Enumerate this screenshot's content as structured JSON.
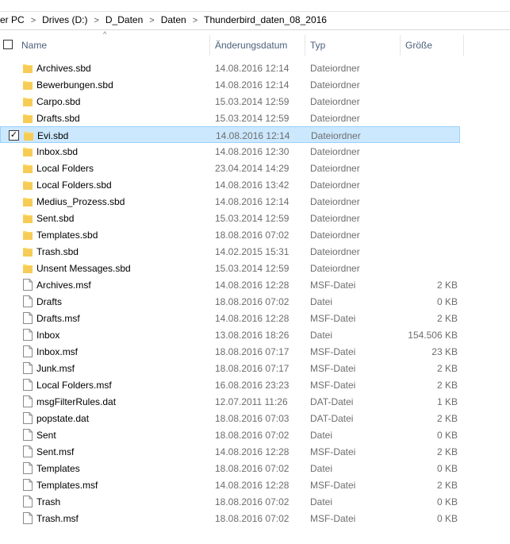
{
  "breadcrumb": [
    "er PC",
    "Drives (D:)",
    "D_Daten",
    "Daten",
    "Thunderbird_daten_08_2016"
  ],
  "columns": {
    "name": "Name",
    "date": "Änderungsdatum",
    "type": "Typ",
    "size": "Größe"
  },
  "colors": {
    "folder": "#ffd75e",
    "folder_dark": "#e6b84a",
    "selection": "#cce8ff",
    "selection_border": "#99d1ff"
  },
  "files": [
    {
      "name": "Archives.sbd",
      "date": "14.08.2016 12:14",
      "type": "Dateiordner",
      "size": "",
      "kind": "folder"
    },
    {
      "name": "Bewerbungen.sbd",
      "date": "14.08.2016 12:14",
      "type": "Dateiordner",
      "size": "",
      "kind": "folder"
    },
    {
      "name": "Carpo.sbd",
      "date": "15.03.2014 12:59",
      "type": "Dateiordner",
      "size": "",
      "kind": "folder"
    },
    {
      "name": "Drafts.sbd",
      "date": "15.03.2014 12:59",
      "type": "Dateiordner",
      "size": "",
      "kind": "folder"
    },
    {
      "name": "Evi.sbd",
      "date": "14.08.2016 12:14",
      "type": "Dateiordner",
      "size": "",
      "kind": "folder",
      "selected": true
    },
    {
      "name": "Inbox.sbd",
      "date": "14.08.2016 12:30",
      "type": "Dateiordner",
      "size": "",
      "kind": "folder"
    },
    {
      "name": "Local Folders",
      "date": "23.04.2014 14:29",
      "type": "Dateiordner",
      "size": "",
      "kind": "folder"
    },
    {
      "name": "Local Folders.sbd",
      "date": "14.08.2016 13:42",
      "type": "Dateiordner",
      "size": "",
      "kind": "folder"
    },
    {
      "name": "Medius_Prozess.sbd",
      "date": "14.08.2016 12:14",
      "type": "Dateiordner",
      "size": "",
      "kind": "folder"
    },
    {
      "name": "Sent.sbd",
      "date": "15.03.2014 12:59",
      "type": "Dateiordner",
      "size": "",
      "kind": "folder"
    },
    {
      "name": "Templates.sbd",
      "date": "18.08.2016 07:02",
      "type": "Dateiordner",
      "size": "",
      "kind": "folder"
    },
    {
      "name": "Trash.sbd",
      "date": "14.02.2015 15:31",
      "type": "Dateiordner",
      "size": "",
      "kind": "folder"
    },
    {
      "name": "Unsent Messages.sbd",
      "date": "15.03.2014 12:59",
      "type": "Dateiordner",
      "size": "",
      "kind": "folder"
    },
    {
      "name": "Archives.msf",
      "date": "14.08.2016 12:28",
      "type": "MSF-Datei",
      "size": "2 KB",
      "kind": "file"
    },
    {
      "name": "Drafts",
      "date": "18.08.2016 07:02",
      "type": "Datei",
      "size": "0 KB",
      "kind": "file"
    },
    {
      "name": "Drafts.msf",
      "date": "14.08.2016 12:28",
      "type": "MSF-Datei",
      "size": "2 KB",
      "kind": "file"
    },
    {
      "name": "Inbox",
      "date": "13.08.2016 18:26",
      "type": "Datei",
      "size": "154.506 KB",
      "kind": "file"
    },
    {
      "name": "Inbox.msf",
      "date": "18.08.2016 07:17",
      "type": "MSF-Datei",
      "size": "23 KB",
      "kind": "file"
    },
    {
      "name": "Junk.msf",
      "date": "18.08.2016 07:17",
      "type": "MSF-Datei",
      "size": "2 KB",
      "kind": "file"
    },
    {
      "name": "Local Folders.msf",
      "date": "16.08.2016 23:23",
      "type": "MSF-Datei",
      "size": "2 KB",
      "kind": "file"
    },
    {
      "name": "msgFilterRules.dat",
      "date": "12.07.2011 11:26",
      "type": "DAT-Datei",
      "size": "1 KB",
      "kind": "file"
    },
    {
      "name": "popstate.dat",
      "date": "18.08.2016 07:03",
      "type": "DAT-Datei",
      "size": "2 KB",
      "kind": "file"
    },
    {
      "name": "Sent",
      "date": "18.08.2016 07:02",
      "type": "Datei",
      "size": "0 KB",
      "kind": "file"
    },
    {
      "name": "Sent.msf",
      "date": "14.08.2016 12:28",
      "type": "MSF-Datei",
      "size": "2 KB",
      "kind": "file"
    },
    {
      "name": "Templates",
      "date": "18.08.2016 07:02",
      "type": "Datei",
      "size": "0 KB",
      "kind": "file"
    },
    {
      "name": "Templates.msf",
      "date": "14.08.2016 12:28",
      "type": "MSF-Datei",
      "size": "2 KB",
      "kind": "file"
    },
    {
      "name": "Trash",
      "date": "18.08.2016 07:02",
      "type": "Datei",
      "size": "0 KB",
      "kind": "file"
    },
    {
      "name": "Trash.msf",
      "date": "18.08.2016 07:02",
      "type": "MSF-Datei",
      "size": "0 KB",
      "kind": "file"
    }
  ]
}
